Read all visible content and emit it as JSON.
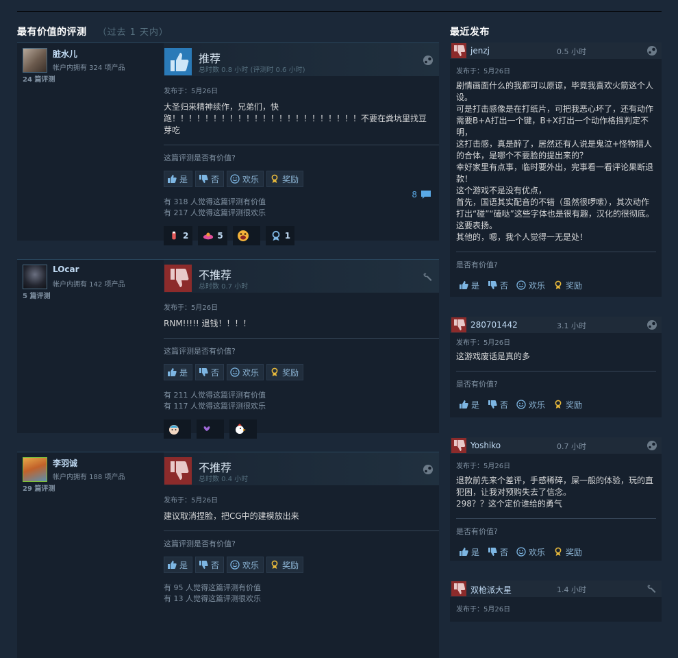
{
  "helpful_section": {
    "title": "最有价值的评测",
    "period": "（过去 1 天内）"
  },
  "recent_section": {
    "title": "最近发布"
  },
  "labels": {
    "yes": "是",
    "no": "否",
    "funny": "欢乐",
    "award": "奖励",
    "helpful_question": "这篇评测是否有价值?",
    "short_question": "是否有价值?"
  },
  "reviews": [
    {
      "author": "脏水儿",
      "owned": "帐户内拥有 324 项产品",
      "review_count": "24 篇评测",
      "verdict": "推荐",
      "recommended": true,
      "hours": "总时数 0.8 小时   (评测时 0.6 小时)",
      "posted": "发布于：5月26日",
      "content": "大圣归来精神续作，兄弟们，快跑！！！！！！！！！！！！！！！！！！！！！！！不要在粪坑里找豆芽吃",
      "helpful": "有 318 人觉得这篇评测有价值",
      "funny": "有 217 人觉得这篇评测很欢乐",
      "comments": "8",
      "awards": [
        {
          "icon": "award-icon-1",
          "count": "2"
        },
        {
          "icon": "award-icon-2",
          "count": "5"
        },
        {
          "icon": "award-icon-3",
          "count": ""
        },
        {
          "icon": "award-icon-4",
          "count": "1"
        }
      ]
    },
    {
      "author": "LOcar",
      "owned": "帐户内拥有 142 项产品",
      "review_count": "5 篇评测",
      "verdict": "不推荐",
      "recommended": false,
      "hours": "总时数 0.7 小时",
      "posted": "发布于：5月26日",
      "content": "RNM!!!!! 退钱！！！！",
      "helpful": "有 211 人觉得这篇评测有价值",
      "funny": "有 117 人觉得这篇评测很欢乐",
      "awards": [
        {
          "icon": "award-icon-5"
        },
        {
          "icon": "award-icon-6"
        },
        {
          "icon": "award-icon-7"
        }
      ]
    },
    {
      "author": "李羽诚",
      "owned": "帐户内拥有 188 项产品",
      "review_count": "29 篇评测",
      "verdict": "不推荐",
      "recommended": false,
      "hours": "总时数 0.4 小时",
      "posted": "发布于：5月26日",
      "content": "建议取消捏脸，把CG中的建模放出来",
      "helpful": "有 95 人觉得这篇评测有价值",
      "funny": "有 13 人觉得这篇评测很欢乐"
    }
  ],
  "recent": [
    {
      "user": "jenzj",
      "hours": "0.5 小时",
      "posted": "发布于：5月26日",
      "content": "剧情画面什么的我都可以原谅，毕竟我喜欢火箭这个人设。\n可是打击感像是在打纸片，可把我恶心坏了，还有动作需要B+A打出一个键，B+X打出一个动作格挡判定不明，\n这打击感，真是醉了，居然还有人说是鬼泣+怪物猎人的合体，是哪个不要脸的提出来的？\n幸好家里有点事，临时要外出，完事看一看评论果断退款！\n这个游戏不是没有优点，\n首先，国语其实配音的不错（虽然很啰嗦），其次动作打出“碰”“磕哒”这些字体也是很有趣，汉化的很彻底。这要表扬。\n其他的，嗯，我个人觉得一无是处！"
    },
    {
      "user": "280701442",
      "hours": "3.1 小时",
      "posted": "发布于：5月26日",
      "content": "这游戏废话是真的多"
    },
    {
      "user": "Yoshiko",
      "hours": "0.7 小时",
      "posted": "发布于：5月26日",
      "content": "退款前先来个差评，手感稀碎，屎一般的体验，玩的直犯困，让我对预购失去了信念。\n298？？这个定价谁给的勇气"
    },
    {
      "user": "双枪派大星",
      "hours": "1.4 小时",
      "posted": "发布于：5月26日"
    }
  ]
}
